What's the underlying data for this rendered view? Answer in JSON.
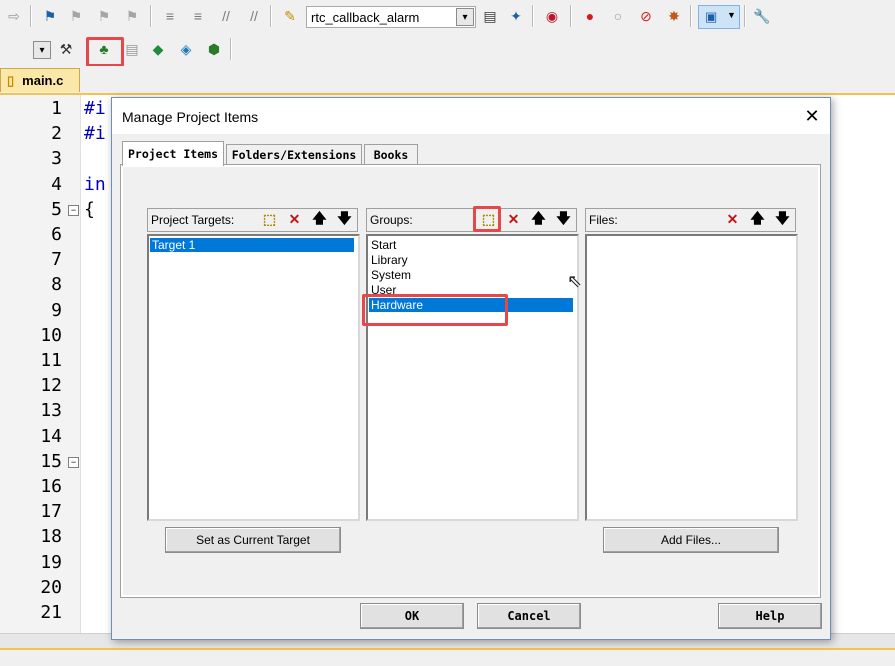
{
  "toolbar1": {
    "target_combo_value": "rtc_callback_alarm"
  },
  "tabbar": {
    "active_tab": "main.c"
  },
  "editor": {
    "line_numbers": [
      "1",
      "2",
      "3",
      "4",
      "5",
      "6",
      "7",
      "8",
      "9",
      "10",
      "11",
      "12",
      "13",
      "14",
      "15",
      "16",
      "17",
      "18",
      "19",
      "20",
      "21"
    ],
    "visible_code": {
      "line1": "#i",
      "line2": "#i",
      "line4": "in",
      "line5": "{"
    }
  },
  "dialog": {
    "title": "Manage Project Items",
    "tabs": [
      "Project Items",
      "Folders/Extensions",
      "Books"
    ],
    "targets": {
      "header": "Project Targets:",
      "items": [
        "Target 1"
      ],
      "selected": "Target 1",
      "button_label": "Set as Current Target"
    },
    "groups": {
      "header": "Groups:",
      "items": [
        "Start",
        "Library",
        "System",
        "User",
        "Hardware"
      ],
      "selected": "Hardware"
    },
    "files": {
      "header": "Files:",
      "items": [],
      "button_label": "Add Files..."
    },
    "buttons": {
      "ok": "OK",
      "cancel": "Cancel",
      "help": "Help"
    }
  },
  "colors": {
    "selection": "#0078d7",
    "highlight_box": "#e5474b",
    "tab_accent": "#f4c34c"
  }
}
